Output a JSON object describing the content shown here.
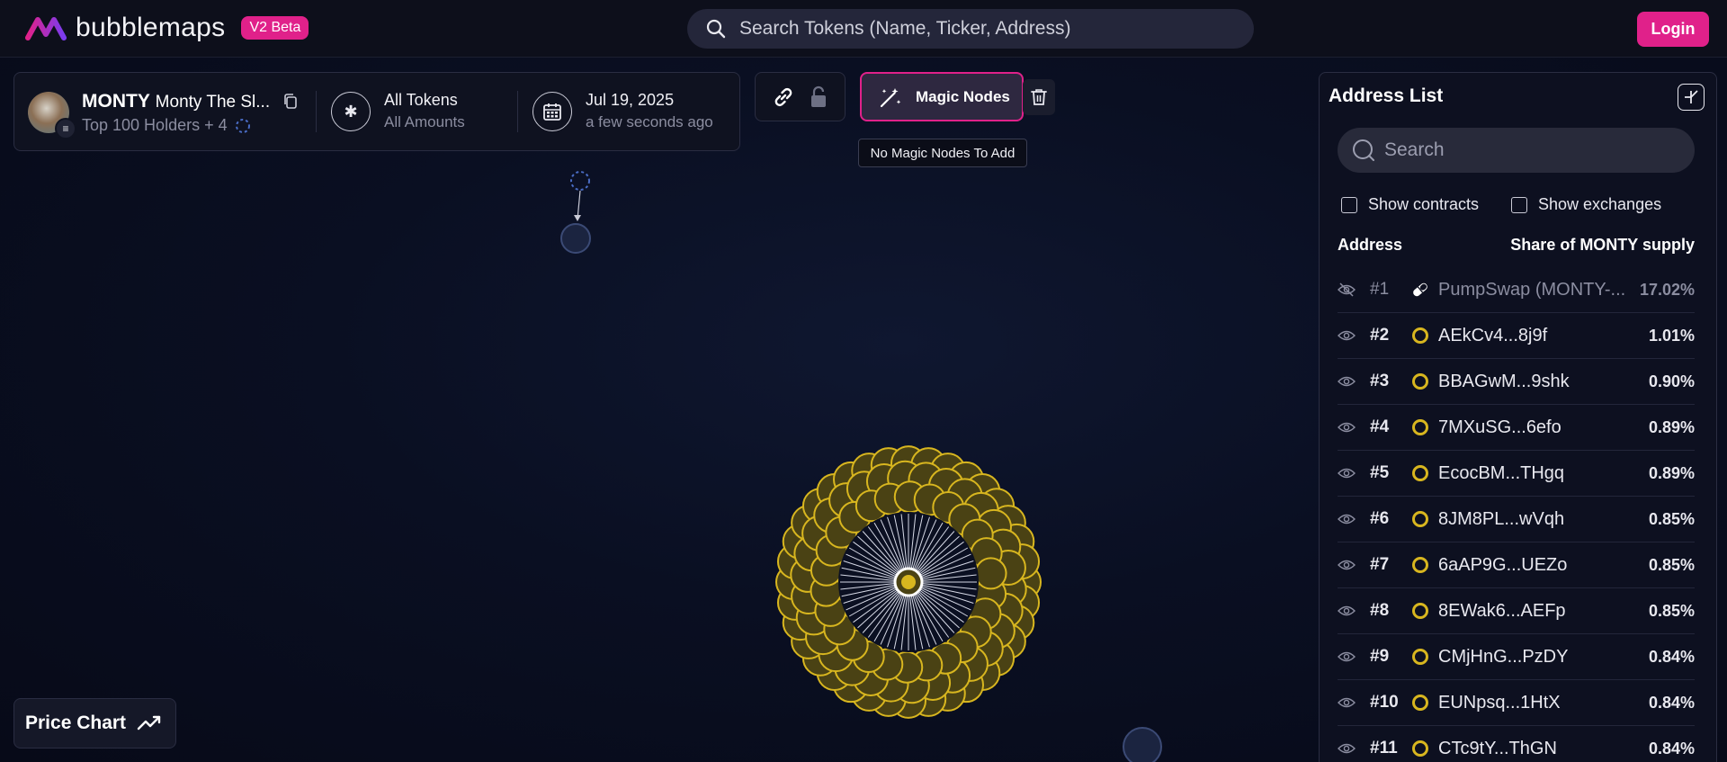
{
  "header": {
    "logo_text": "bubblemaps",
    "beta_badge": "V2 Beta",
    "search_placeholder": "Search Tokens (Name, Ticker, Address)",
    "login_label": "Login"
  },
  "token": {
    "ticker": "MONTY",
    "name": "Monty The Sl...",
    "holders_label": "Top 100 Holders + 4",
    "tokens_filter": "All Tokens",
    "amounts_filter": "All Amounts",
    "date": "Jul 19, 2025",
    "date_relative": "a few seconds ago"
  },
  "toolbar": {
    "magic_nodes_label": "Magic Nodes",
    "tooltip": "No Magic Nodes To Add"
  },
  "price_chart_label": "Price Chart",
  "address_list": {
    "title": "Address List",
    "search_placeholder": "Search",
    "show_contracts": "Show contracts",
    "show_exchanges": "Show exchanges",
    "col_address": "Address",
    "col_share": "Share of MONTY supply",
    "rows": [
      {
        "rank": "#1",
        "address": "PumpSwap (MONTY-...",
        "share": "17.02%"
      },
      {
        "rank": "#2",
        "address": "AEkCv4...8j9f",
        "share": "1.01%"
      },
      {
        "rank": "#3",
        "address": "BBAGwM...9shk",
        "share": "0.90%"
      },
      {
        "rank": "#4",
        "address": "7MXuSG...6efo",
        "share": "0.89%"
      },
      {
        "rank": "#5",
        "address": "EcocBM...THgq",
        "share": "0.89%"
      },
      {
        "rank": "#6",
        "address": "8JM8PL...wVqh",
        "share": "0.85%"
      },
      {
        "rank": "#7",
        "address": "6aAP9G...UEZo",
        "share": "0.85%"
      },
      {
        "rank": "#8",
        "address": "8EWak6...AEFp",
        "share": "0.85%"
      },
      {
        "rank": "#9",
        "address": "CMjHnG...PzDY",
        "share": "0.84%"
      },
      {
        "rank": "#10",
        "address": "EUNpsq...1HtX",
        "share": "0.84%"
      },
      {
        "rank": "#11",
        "address": "CTc9tY...ThGN",
        "share": "0.84%"
      }
    ]
  },
  "colors": {
    "accent": "#e0218a",
    "bubble": "#d8b61f",
    "background": "#0a0f22"
  }
}
